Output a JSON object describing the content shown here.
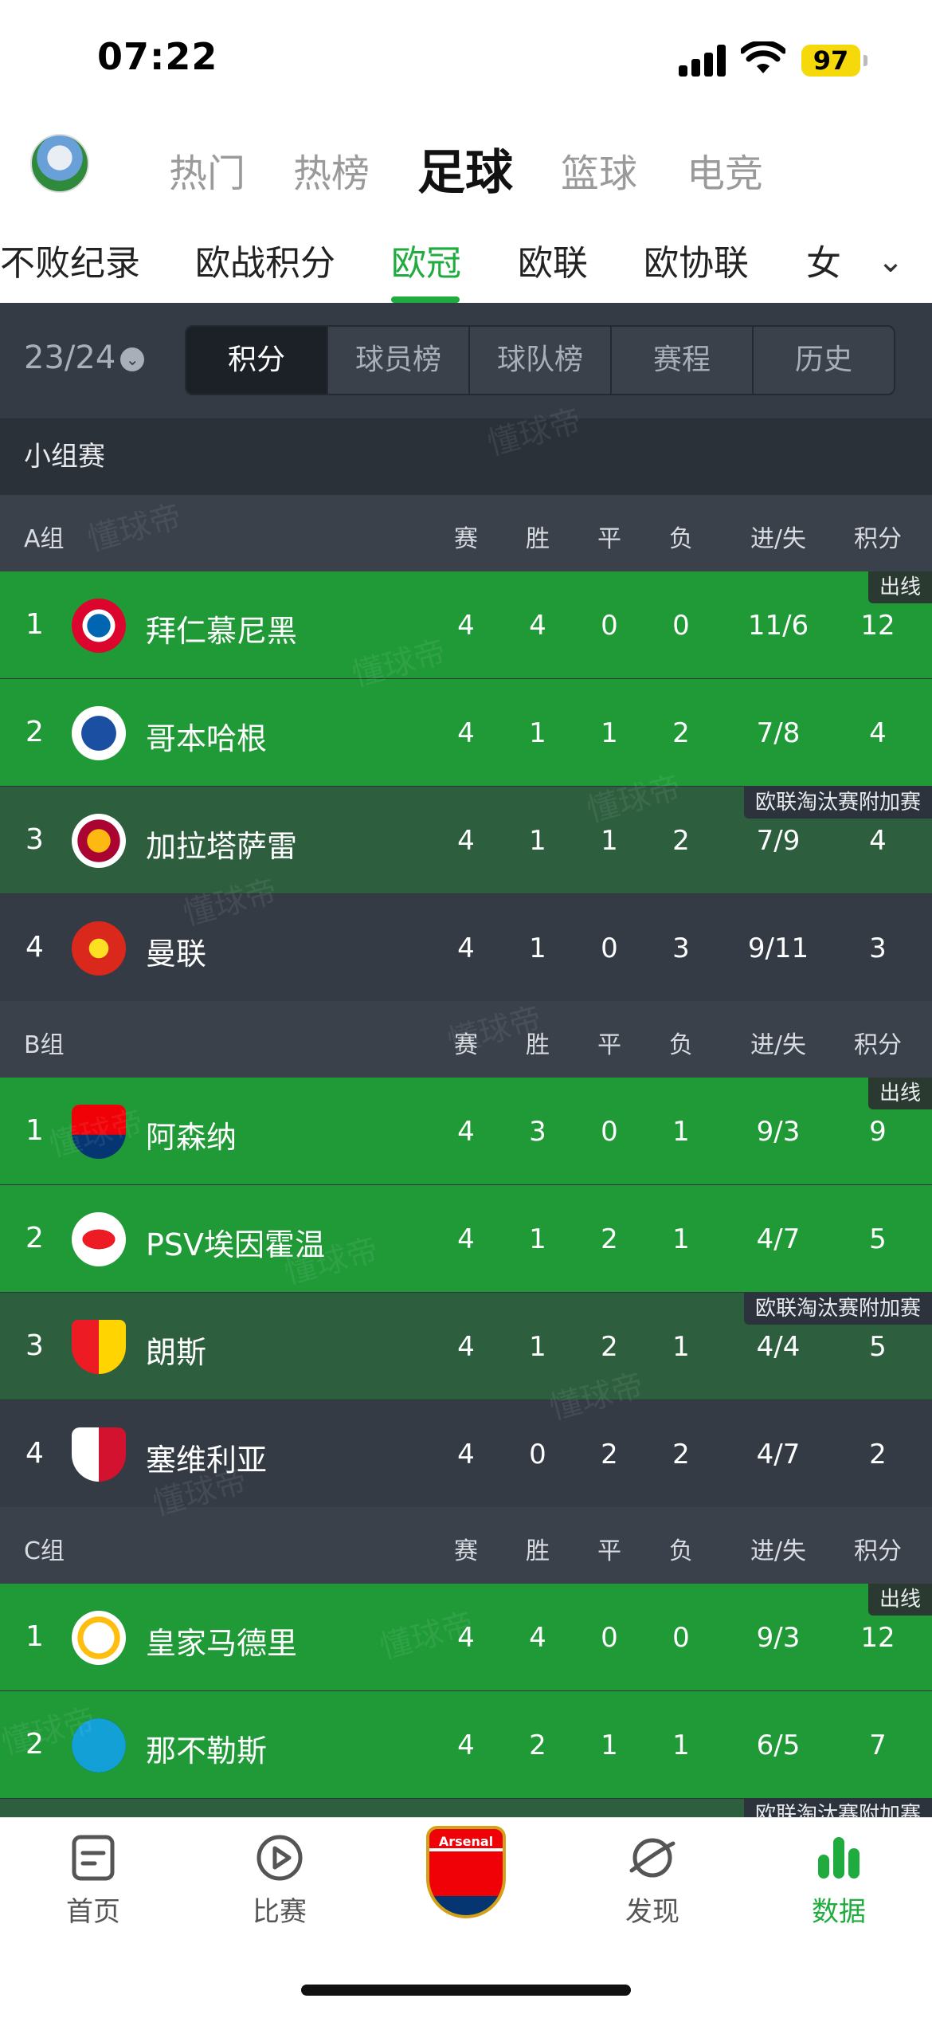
{
  "status": {
    "time": "07:22",
    "battery": "97"
  },
  "topnav": {
    "tabs": [
      "热门",
      "热榜",
      "足球",
      "篮球",
      "电竞"
    ],
    "active": "足球"
  },
  "subnav": {
    "tabs": [
      "不败纪录",
      "欧战积分",
      "欧冠",
      "欧联",
      "欧协联",
      "女"
    ],
    "active": "欧冠"
  },
  "filter": {
    "season": "23/24",
    "segments": [
      "积分",
      "球员榜",
      "球队榜",
      "赛程",
      "历史"
    ],
    "active": "积分"
  },
  "stage_label": "小组赛",
  "columns": [
    "赛",
    "胜",
    "平",
    "负",
    "进/失",
    "积分"
  ],
  "tags": {
    "qualify": "出线",
    "europa": "欧联淘汰赛附加赛"
  },
  "groups": [
    {
      "name": "A组",
      "teams": [
        {
          "rank": "1",
          "name": "拜仁慕尼黑",
          "p": "4",
          "w": "4",
          "d": "0",
          "l": "0",
          "gd": "11/6",
          "pts": "12"
        },
        {
          "rank": "2",
          "name": "哥本哈根",
          "p": "4",
          "w": "1",
          "d": "1",
          "l": "2",
          "gd": "7/8",
          "pts": "4"
        },
        {
          "rank": "3",
          "name": "加拉塔萨雷",
          "p": "4",
          "w": "1",
          "d": "1",
          "l": "2",
          "gd": "7/9",
          "pts": "4"
        },
        {
          "rank": "4",
          "name": "曼联",
          "p": "4",
          "w": "1",
          "d": "0",
          "l": "3",
          "gd": "9/11",
          "pts": "3"
        }
      ]
    },
    {
      "name": "B组",
      "teams": [
        {
          "rank": "1",
          "name": "阿森纳",
          "p": "4",
          "w": "3",
          "d": "0",
          "l": "1",
          "gd": "9/3",
          "pts": "9"
        },
        {
          "rank": "2",
          "name": "PSV埃因霍温",
          "p": "4",
          "w": "1",
          "d": "2",
          "l": "1",
          "gd": "4/7",
          "pts": "5"
        },
        {
          "rank": "3",
          "name": "朗斯",
          "p": "4",
          "w": "1",
          "d": "2",
          "l": "1",
          "gd": "4/4",
          "pts": "5"
        },
        {
          "rank": "4",
          "name": "塞维利亚",
          "p": "4",
          "w": "0",
          "d": "2",
          "l": "2",
          "gd": "4/7",
          "pts": "2"
        }
      ]
    },
    {
      "name": "C组",
      "teams": [
        {
          "rank": "1",
          "name": "皇家马德里",
          "p": "4",
          "w": "4",
          "d": "0",
          "l": "0",
          "gd": "9/3",
          "pts": "12"
        },
        {
          "rank": "2",
          "name": "那不勒斯",
          "p": "4",
          "w": "2",
          "d": "1",
          "l": "1",
          "gd": "6/5",
          "pts": "7"
        }
      ]
    }
  ],
  "watermark": "懂球帝",
  "tabbar": {
    "items": [
      "首页",
      "比赛",
      "",
      "发现",
      "数据"
    ],
    "active": "数据",
    "center_badge": "Arsenal"
  }
}
